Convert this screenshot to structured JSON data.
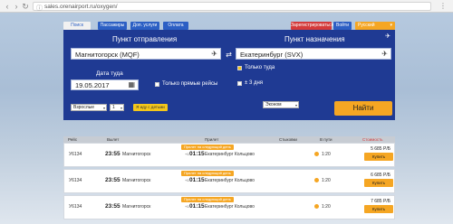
{
  "browser": {
    "url": "sales.orenairport.ru/oxygen/"
  },
  "nav": {
    "search": "Поиск",
    "passengers": "Пассажиры",
    "extra": "Доп. услуги",
    "payment": "Оплата",
    "register": "Зарегистрироваться",
    "login": "Войти",
    "language": "Русский"
  },
  "search": {
    "from_label": "Пункт отправления",
    "to_label": "Пункт назначения",
    "from_value": "Магнитогорск (MQF)",
    "to_value": "Екатеринбург (SVX)",
    "date_label": "Дата туда",
    "date_value": "19.05.2017",
    "direct_only": "Только прямые рейсы",
    "one_way": "Только туда",
    "plus_minus": "± 3 дня",
    "passenger_type": "Взрослые",
    "passenger_count": "1",
    "kids_button": "Я иду с детьми",
    "cabin": "Эконом",
    "find_button": "Найти"
  },
  "results": {
    "columns": {
      "flight": "Рейс",
      "departure": "Вылет",
      "arrival": "Прилет",
      "stops": "Стыковки",
      "duration": "В пути",
      "price": "Стоимость"
    },
    "rows": [
      {
        "code": "У6134",
        "dep_time": "23:55",
        "dep_city": "Магнитогорск",
        "next_day": "Прилет на следующий день",
        "plus": "+1",
        "arr_time": "01:15",
        "arr_city": "Екатеринбург Кольцово",
        "duration": "1:20",
        "price": "5 685 Р/Б",
        "buy": "Купить"
      },
      {
        "code": "У6134",
        "dep_time": "23:55",
        "dep_city": "Магнитогорск",
        "next_day": "Прилет на следующий день",
        "plus": "+1",
        "arr_time": "01:15",
        "arr_city": "Екатеринбург Кольцово",
        "duration": "1:20",
        "price": "6 685 Р/Б",
        "buy": "Купить"
      },
      {
        "code": "У6134",
        "dep_time": "23:55",
        "dep_city": "Магнитогорск",
        "next_day": "Прилет на следующий день",
        "plus": "+1",
        "arr_time": "01:15",
        "arr_city": "Екатеринбург Кольцово",
        "duration": "1:20",
        "price": "7 685 Р/Б",
        "buy": "Купить"
      }
    ]
  }
}
